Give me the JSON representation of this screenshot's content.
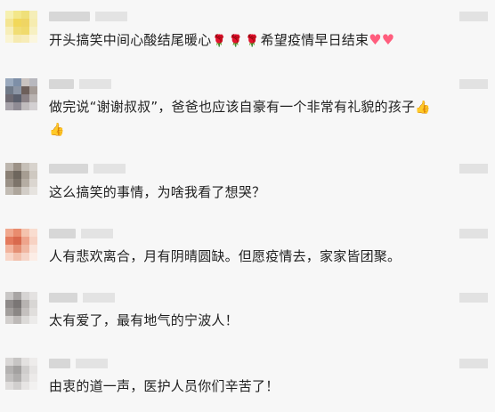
{
  "comments": [
    {
      "text": "开头搞笑中间心酸结尾暖心",
      "emojis_mid": [
        "rose-icon",
        "rose-icon",
        "rose-icon"
      ],
      "text2": "希望疫情早日结束",
      "emojis_end": [
        "heart-icon",
        "heart-icon"
      ]
    },
    {
      "text": "做完说“谢谢叔叔”，爸爸也应该自豪有一个非常有礼貌的孩子",
      "emojis_end": [
        "thumbs-up-icon",
        "thumbs-up-icon"
      ]
    },
    {
      "text": "这么搞笑的事情，为啥我看了想哭？"
    },
    {
      "text": "人有悲欢离合，月有阴晴圆缺。但愿疫情去，家家皆团聚。"
    },
    {
      "text": "太有爱了，最有地气的宁波人！"
    },
    {
      "text": "由衷的道一声，医护人员你们辛苦了！"
    }
  ],
  "colors": {
    "background": "#f7f7f7",
    "text": "#1f1f1f",
    "rose": "#d81e2a",
    "heart": "#ff5d7d",
    "thumb": "#f3b51c"
  }
}
